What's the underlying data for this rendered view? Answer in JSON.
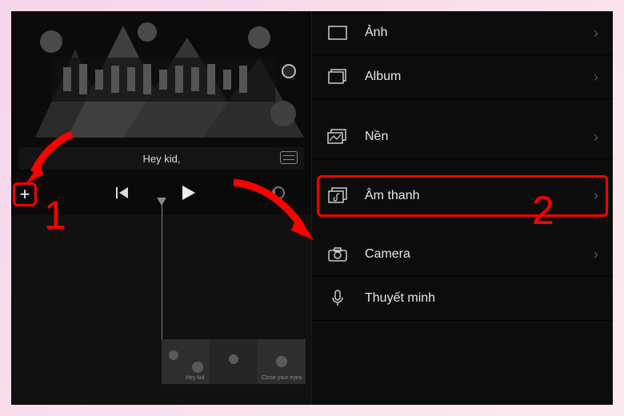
{
  "preview": {
    "caption": "Hey kid,"
  },
  "controls": {
    "add_label": "+"
  },
  "menu": {
    "items": [
      {
        "label": "Ảnh",
        "icon": "image-icon"
      },
      {
        "label": "Album",
        "icon": "album-icon"
      },
      {
        "label": "Nền",
        "icon": "background-icon"
      },
      {
        "label": "Âm thanh",
        "icon": "audio-icon"
      },
      {
        "label": "Camera",
        "icon": "camera-icon"
      },
      {
        "label": "Thuyết minh",
        "icon": "voiceover-icon"
      }
    ]
  },
  "annotations": {
    "step1": "1",
    "step2": "2"
  }
}
